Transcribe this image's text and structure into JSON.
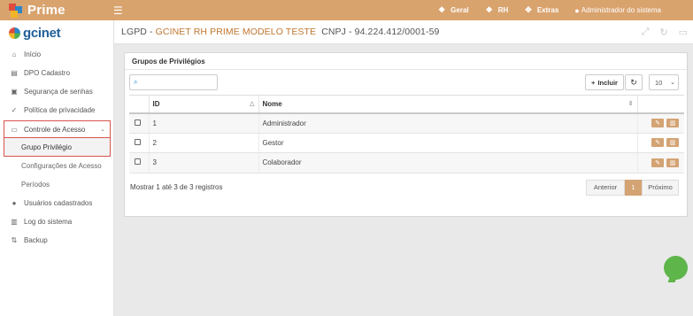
{
  "app": {
    "brand_name": "Prime"
  },
  "topnav": {
    "items": [
      {
        "label": "Geral",
        "icon": "cube-icon"
      },
      {
        "label": "RH",
        "icon": "cube-icon"
      },
      {
        "label": "Extras",
        "icon": "cubes-icon"
      }
    ],
    "user": "Administrador do sistema"
  },
  "sidebar": {
    "logo": "gcinet",
    "items": [
      {
        "label": "Início",
        "icon": "home-icon"
      },
      {
        "label": "DPO Cadastro",
        "icon": "file-icon"
      },
      {
        "label": "Segurança de senhas",
        "icon": "lock-icon"
      },
      {
        "label": "Política de privacidade",
        "icon": "check-icon"
      }
    ],
    "group": {
      "label": "Controle de Acesso",
      "icon": "id-card-icon",
      "children": [
        {
          "label": "Grupo Privilégio",
          "active": true
        },
        {
          "label": "Configurações de Acesso"
        },
        {
          "label": "Períodos"
        }
      ]
    },
    "bottom_items": [
      {
        "label": "Usuários cadastrados",
        "icon": "user-icon"
      },
      {
        "label": "Log do sistema",
        "icon": "log-icon"
      },
      {
        "label": "Backup",
        "icon": "backup-icon"
      }
    ]
  },
  "header": {
    "prefix": "LGPD - ",
    "company": "GCINET RH PRIME MODELO TESTE",
    "cnpj": "  CNPJ - 94.224.412/0001-59"
  },
  "panel": {
    "title": "Grupos de Privilégios",
    "search_placeholder": "",
    "incluir_label": "Incluir",
    "page_size": "10",
    "columns": [
      "ID",
      "Nome"
    ],
    "rows": [
      {
        "id": "1",
        "nome": "Administrador"
      },
      {
        "id": "2",
        "nome": "Gestor"
      },
      {
        "id": "3",
        "nome": "Colaborador"
      }
    ],
    "records_text": "Mostrar 1 até 3 de 3 registros",
    "pager": {
      "prev": "Anterior",
      "current": "1",
      "next": "Próximo"
    }
  },
  "colors": {
    "topbar": "#d9a36e",
    "accent": "#d4a373",
    "highlight_border": "#d9534f",
    "chat": "#5eb54a"
  }
}
